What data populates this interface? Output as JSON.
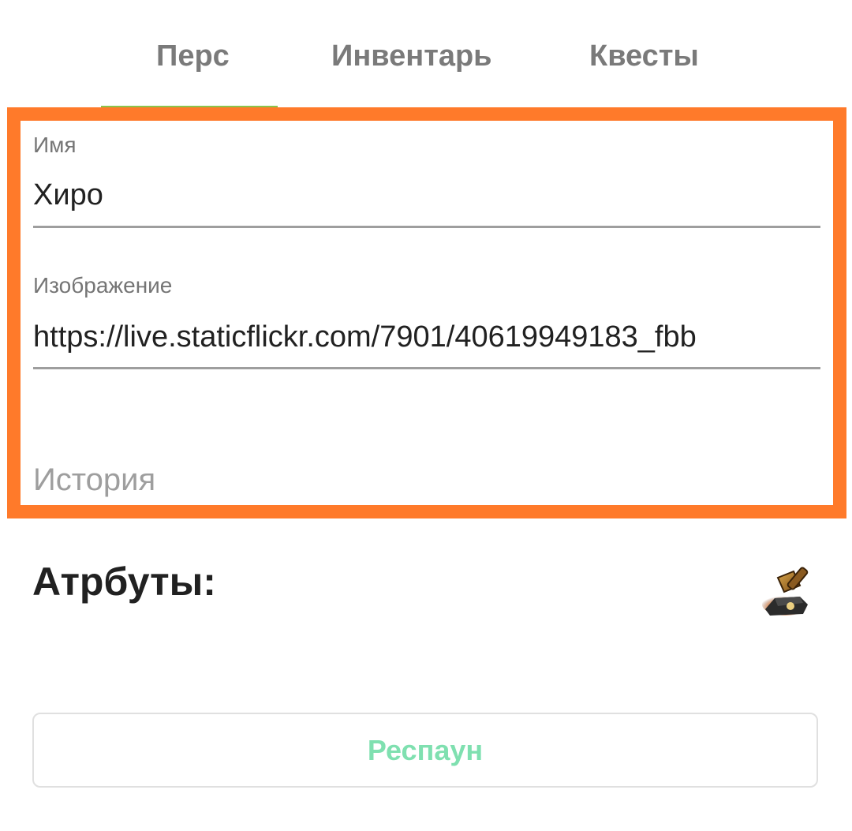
{
  "tabs": [
    {
      "label": "Перс",
      "active": true
    },
    {
      "label": "Инвентарь",
      "active": false
    },
    {
      "label": "Квесты",
      "active": false
    }
  ],
  "colors": {
    "tab_indicator": "#8bc34a",
    "highlight_frame": "#ff7a2a",
    "respawn_text": "#7fe0b0"
  },
  "form": {
    "name": {
      "label": "Имя",
      "value": "Хиро"
    },
    "image": {
      "label": "Изображение",
      "value": "https://live.staticflickr.com/7901/40619949183_fbb"
    },
    "history": {
      "placeholder": "История",
      "value": ""
    }
  },
  "attributes": {
    "heading": "Атрбуты:",
    "icon": "anvil-hammer-icon"
  },
  "respawn": {
    "label": "Респаун"
  }
}
